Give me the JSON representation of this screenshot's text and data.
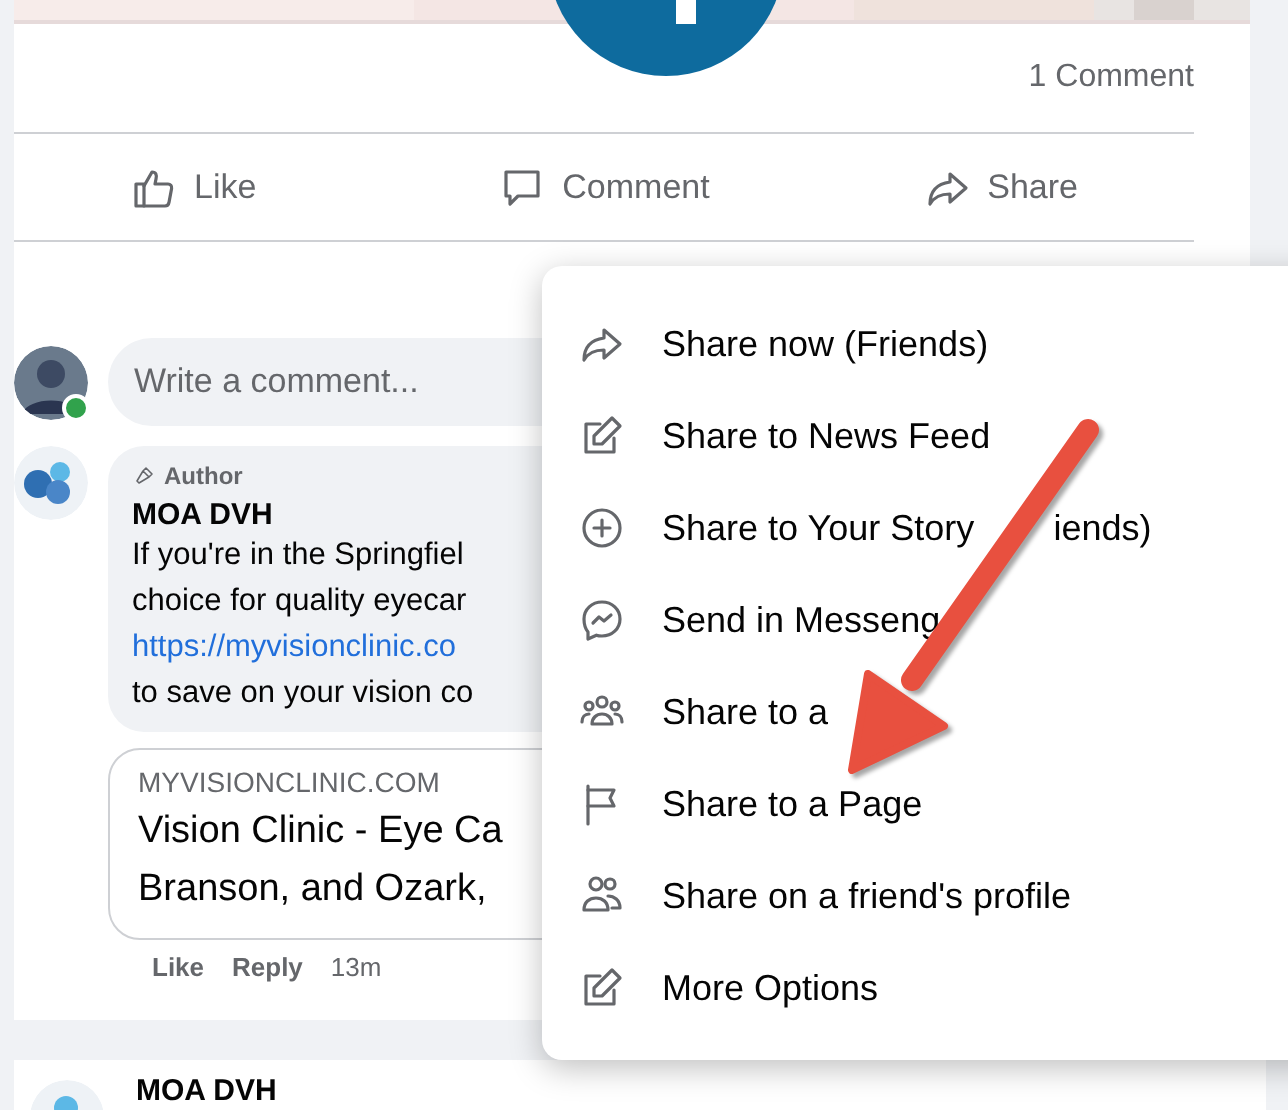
{
  "post": {
    "comment_count": "1 Comment",
    "actions": [
      {
        "label": "Like",
        "kind": "like"
      },
      {
        "label": "Comment",
        "kind": "comment"
      },
      {
        "label": "Share",
        "kind": "share"
      }
    ]
  },
  "comment_box": {
    "placeholder": "Write a comment...",
    "online": true
  },
  "comment": {
    "badge": "Author",
    "author": "MOA DVH",
    "body": [
      {
        "kind": "text",
        "text": "If you're in the Springfiel"
      },
      {
        "kind": "text",
        "text": "choice for quality eyecar"
      },
      {
        "kind": "link",
        "text": "https://myvisionclinic.co"
      },
      {
        "kind": "text",
        "text": "to save on your vision co"
      }
    ],
    "preview": {
      "domain": "MYVISIONCLINIC.COM",
      "title_lines": [
        "Vision Clinic - Eye Ca",
        "Branson, and Ozark,"
      ]
    },
    "actions": [
      "Like",
      "Reply"
    ],
    "time": "13m"
  },
  "next_post": {
    "author": "MOA DVH"
  },
  "share_menu": {
    "items": [
      {
        "parts": [
          "Share now (Friends)"
        ],
        "kind": "share"
      },
      {
        "parts": [
          "Share to News Feed"
        ],
        "kind": "edit"
      },
      {
        "parts": [
          "Share to Your Story",
          "iends)"
        ],
        "kind": "story"
      },
      {
        "parts": [
          "Send in Messeng"
        ],
        "kind": "messenger"
      },
      {
        "parts": [
          "Share to a"
        ],
        "kind": "group"
      },
      {
        "parts": [
          "Share to a Page"
        ],
        "kind": "flag"
      },
      {
        "parts": [
          "Share on a friend's profile"
        ],
        "kind": "friend"
      },
      {
        "parts": [
          "More Options"
        ],
        "kind": "edit"
      }
    ]
  }
}
